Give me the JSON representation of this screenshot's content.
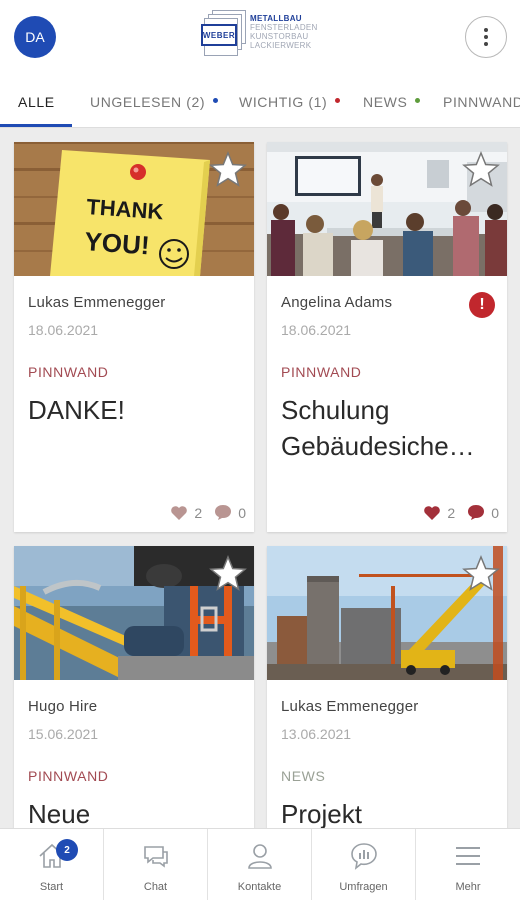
{
  "header": {
    "avatar_initials": "DA",
    "logo": {
      "brand": "WEBER",
      "lines": [
        "METALLBAU",
        "FENSTERLADEN",
        "KUNSTORBAU",
        "LACKIERWERK"
      ]
    }
  },
  "tabs": [
    {
      "label": "ALLE",
      "active": true
    },
    {
      "label": "UNGELESEN (2)",
      "dot_color": "#1f4bb4"
    },
    {
      "label": "WICHTIG (1)",
      "dot_color": "#c1272d"
    },
    {
      "label": "NEWS",
      "dot_color": "#5e9c3c"
    },
    {
      "label": "PINNWAND"
    }
  ],
  "cards": [
    {
      "author": "Lukas Emmenegger",
      "date": "18.06.2021",
      "category": "PINNWAND",
      "title": "DANKE!",
      "likes": "2",
      "comments": "0",
      "liked": false,
      "image": "thank-you-sticky-note",
      "note_text_1": "THANK",
      "note_text_2": "YOU!"
    },
    {
      "author": "Angelina Adams",
      "date": "18.06.2021",
      "category": "PINNWAND",
      "title_line1": "Schulung",
      "title_line2": "Gebäudesiche…",
      "likes": "2",
      "comments": "0",
      "liked": true,
      "important": "!",
      "image": "training-seminar"
    },
    {
      "author": "Hugo Hire",
      "date": "15.06.2021",
      "category": "PINNWAND",
      "title": "Neue",
      "image": "safety-harness-worker"
    },
    {
      "author": "Lukas Emmenegger",
      "date": "13.06.2021",
      "category": "NEWS",
      "title": "Projekt",
      "image": "construction-site-crane"
    }
  ],
  "bottom_nav": [
    {
      "label": "Start",
      "icon": "home-icon",
      "badge": "2"
    },
    {
      "label": "Chat",
      "icon": "chat-icon"
    },
    {
      "label": "Kontakte",
      "icon": "contacts-icon"
    },
    {
      "label": "Umfragen",
      "icon": "poll-icon"
    },
    {
      "label": "Mehr",
      "icon": "menu-icon"
    }
  ],
  "colors": {
    "accent": "#1f4bb4",
    "pinnwand": "#a24a52",
    "alert": "#c1272d",
    "heart_active": "#a3303a"
  }
}
